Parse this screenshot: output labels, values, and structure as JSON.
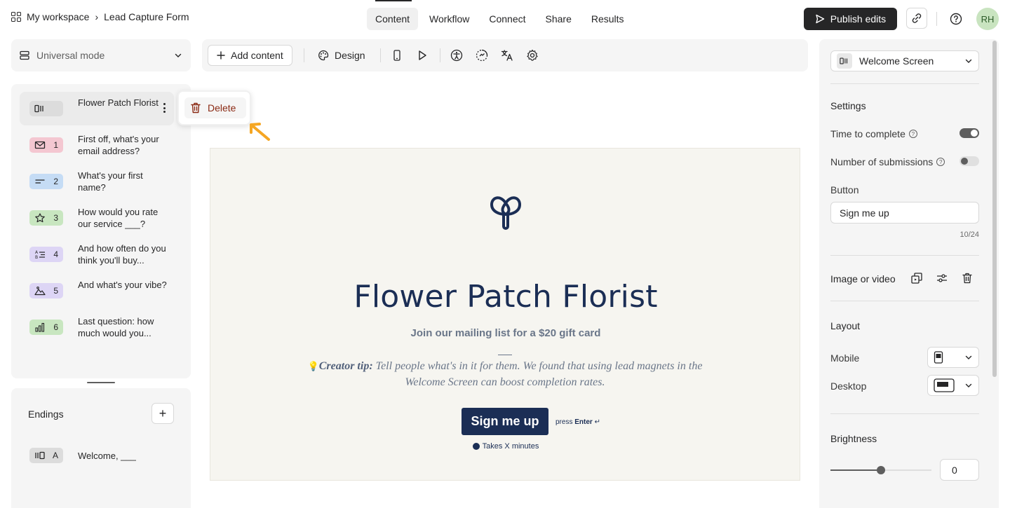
{
  "breadcrumb": {
    "workspace": "My workspace",
    "form": "Lead Capture Form"
  },
  "tabs": [
    {
      "label": "Content",
      "active": true
    },
    {
      "label": "Workflow",
      "active": false
    },
    {
      "label": "Connect",
      "active": false
    },
    {
      "label": "Share",
      "active": false
    },
    {
      "label": "Results",
      "active": false
    }
  ],
  "header": {
    "publish_label": "Publish edits",
    "avatar_initials": "RH"
  },
  "left": {
    "mode_label": "Universal mode",
    "questions": [
      {
        "number": "",
        "label": "Flower Patch Florist",
        "icon": "welcome-screen-icon",
        "color": "#dcdcdc",
        "active": true
      },
      {
        "number": "1",
        "label": "First off, what's your email address?",
        "icon": "mail-icon",
        "color": "#f4c7d1",
        "active": false
      },
      {
        "number": "2",
        "label": "What's your first name?",
        "icon": "short-text-icon",
        "color": "#c5dcf5",
        "active": false
      },
      {
        "number": "3",
        "label": "How would you rate our service ___?",
        "icon": "star-icon",
        "color": "#c8e6c0",
        "active": false
      },
      {
        "number": "4",
        "label": "And how often do you think you'll buy...",
        "icon": "multiple-choice-icon",
        "color": "#ddd5f5",
        "active": false
      },
      {
        "number": "5",
        "label": "And what's your vibe?",
        "icon": "picture-choice-icon",
        "color": "#ddd5f5",
        "active": false
      },
      {
        "number": "6",
        "label": "Last question: how much would you...",
        "icon": "chart-bar-icon",
        "color": "#c8e6c0",
        "active": false
      }
    ],
    "endings_title": "Endings",
    "endings": [
      {
        "letter": "A",
        "label": "Welcome, ___",
        "icon": "ending-screen-icon"
      }
    ]
  },
  "popup": {
    "delete_label": "Delete"
  },
  "toolbar": {
    "add_content_label": "Add content",
    "design_label": "Design"
  },
  "canvas": {
    "title": "Flower Patch Florist",
    "subtitle": "Join our mailing list for a $20 gift card",
    "tip_emoji": "💡",
    "tip_bold": "Creator tip:",
    "tip_text": " Tell people what's in it for them. We found that using lead magnets in the Welcome Screen can boost completion rates.",
    "button_label": "Sign me up",
    "press_prefix": "press ",
    "press_key": "Enter",
    "press_symbol": " ↵",
    "takes_label": "Takes X minutes"
  },
  "right": {
    "block_type": "Welcome Screen",
    "settings_title": "Settings",
    "time_to_complete_label": "Time to complete",
    "time_to_complete_on": true,
    "submissions_label": "Number of submissions",
    "submissions_on": false,
    "button_section_label": "Button",
    "button_value": "Sign me up",
    "button_counter": "10/24",
    "image_video_label": "Image or video",
    "layout_title": "Layout",
    "mobile_label": "Mobile",
    "desktop_label": "Desktop",
    "brightness_title": "Brightness",
    "brightness_value": "0",
    "brightness_fraction": 0.5
  },
  "colors": {
    "accent_dark": "#262627",
    "form_navy": "#1b2e55",
    "annotation_arrow": "#f5a623"
  }
}
